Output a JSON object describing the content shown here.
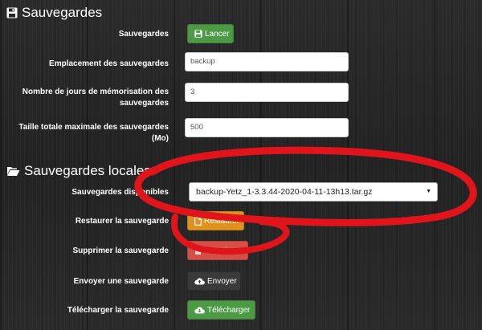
{
  "section_backups": {
    "heading": "Sauvegardes",
    "launch_label": "Sauvegardes",
    "launch_button": "Lancer",
    "location_label": "Emplacement des sauvegardes",
    "location_value": "backup",
    "days_label_line1": "Nombre de jours de mémorisation des",
    "days_label_line2": "sauvegardes",
    "days_value": "3",
    "size_label_line1": "Taille totale maximale des sauvegardes",
    "size_label_line2": "(Mo)",
    "size_value": "500"
  },
  "section_local": {
    "heading": "Sauvegardes locales",
    "available_label": "Sauvegardes disponibles",
    "available_selected": "backup-Yetz_1-3.3.44-2020-04-11-13h13.tar.gz",
    "restore_label": "Restaurer la sauvegarde",
    "restore_button": "Restaurer",
    "delete_label": "Supprimer la sauvegarde",
    "delete_button": "Supprimer",
    "upload_label": "Envoyer une sauvegarde",
    "upload_button": "Envoyer",
    "download_label": "Télécharger la sauvegarde",
    "download_button": "Télécharger"
  },
  "colors": {
    "green": "#4c9a45",
    "orange": "#e0931c",
    "red": "#d34f48",
    "annotation": "#e0151b"
  },
  "icons": {
    "section_backups": "floppy-disk-icon",
    "section_local": "folder-open-icon",
    "launch": "floppy-disk-icon",
    "restore": "file-icon",
    "delete": "trash-icon",
    "upload": "cloud-upload-icon",
    "download": "cloud-download-icon"
  }
}
